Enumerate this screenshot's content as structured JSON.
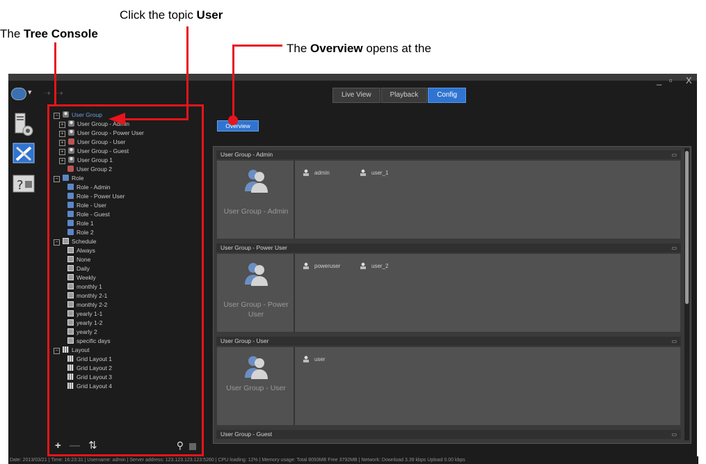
{
  "annotations": {
    "tree_console_pre": "The ",
    "tree_console_bold": "Tree Console",
    "click_topic_pre": "Click the topic ",
    "click_topic_bold": "User",
    "overview_pre": "The ",
    "overview_bold": "Overview",
    "overview_post": " opens at the"
  },
  "window": {
    "controls": [
      "_",
      "▫",
      "X"
    ]
  },
  "tabs": [
    {
      "label": "Live View",
      "active": false
    },
    {
      "label": "Playback",
      "active": false
    },
    {
      "label": "Config",
      "active": true
    }
  ],
  "tree": {
    "user_groups": {
      "label": "User Group",
      "children": [
        {
          "label": "User Group - Admin"
        },
        {
          "label": "User Group - Power User"
        },
        {
          "label": "User Group - User"
        },
        {
          "label": "User Group - Guest"
        },
        {
          "label": "User Group 1"
        },
        {
          "label": "User Group 2"
        }
      ]
    },
    "roles": {
      "label": "Role",
      "children": [
        {
          "label": "Role - Admin"
        },
        {
          "label": "Role - Power User"
        },
        {
          "label": "Role - User"
        },
        {
          "label": "Role - Guest"
        },
        {
          "label": "Role 1"
        },
        {
          "label": "Role 2"
        }
      ]
    },
    "schedules": {
      "label": "Schedule",
      "children": [
        {
          "label": "Always"
        },
        {
          "label": "None"
        },
        {
          "label": "Daily"
        },
        {
          "label": "Weekly"
        },
        {
          "label": "monthly 1"
        },
        {
          "label": "monthly 2-1"
        },
        {
          "label": "monthly 2-2"
        },
        {
          "label": "yearly 1-1"
        },
        {
          "label": "yearly 1-2"
        },
        {
          "label": "yearly 2"
        },
        {
          "label": "specific days"
        }
      ]
    },
    "layouts": {
      "label": "Layout",
      "children": [
        {
          "label": "Grid Layout 1"
        },
        {
          "label": "Grid Layout 2"
        },
        {
          "label": "Grid Layout 3"
        },
        {
          "label": "Grid Layout 4"
        }
      ]
    },
    "tools": {
      "add": "+",
      "remove": "—",
      "sort": "⇅",
      "search": "⚲"
    }
  },
  "overview_button": "Overview",
  "sections": [
    {
      "header": "User Group - Admin",
      "name": "User Group - Admin",
      "members": [
        "admin",
        "user_1"
      ]
    },
    {
      "header": "User Group - Power User",
      "name": "User Group - Power User",
      "members": [
        "poweruser",
        "user_2"
      ]
    },
    {
      "header": "User Group - User",
      "name": "User Group - User",
      "members": [
        "user"
      ]
    },
    {
      "header": "User Group - Guest",
      "name": "",
      "members": []
    }
  ],
  "status_bar": "Date: 2013/03/21 | Time: 16:23:31 | Username: admin | Server address: 123.123.123.123:5260 | CPU loading: 12% | Memory usage: Total 8093MB  Free 3792MB | Network: Download   3.39 kbps Upload   0.00 kbps",
  "colors": {
    "accent": "#2f74d0",
    "annotation_red": "#e8141b",
    "window_bg": "#1c1c1c"
  }
}
